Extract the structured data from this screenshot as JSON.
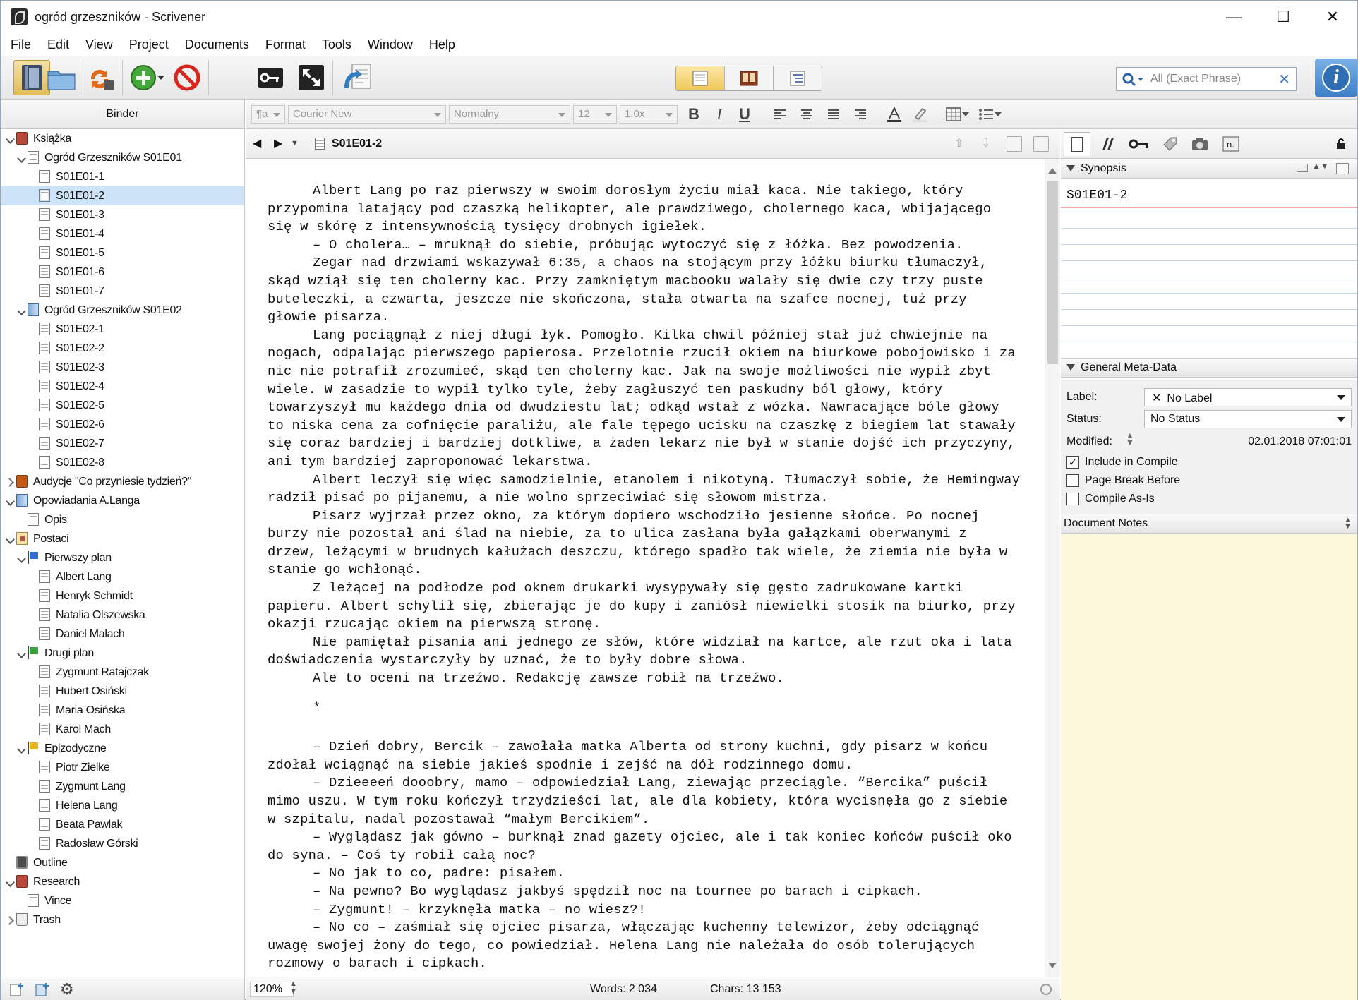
{
  "window": {
    "title": "ogród grzeszników - Scrivener",
    "minimize": "—",
    "maximize": "☐",
    "close": "✕"
  },
  "menu": [
    "File",
    "Edit",
    "View",
    "Project",
    "Documents",
    "Format",
    "Tools",
    "Window",
    "Help"
  ],
  "toolbar": {
    "search_placeholder": "All (Exact Phrase)",
    "search_clear": "✕",
    "info": "i"
  },
  "binder": {
    "header": "Binder",
    "tree": [
      {
        "label": "Książka",
        "icon": "book",
        "depth": 0,
        "tw": "open"
      },
      {
        "label": "Ogród Grzeszników S01E01",
        "icon": "doc",
        "depth": 1,
        "tw": "open"
      },
      {
        "label": "S01E01-1",
        "icon": "doc",
        "depth": 2
      },
      {
        "label": "S01E01-2",
        "icon": "doc",
        "depth": 2,
        "sel": true
      },
      {
        "label": "S01E01-3",
        "icon": "doc",
        "depth": 2
      },
      {
        "label": "S01E01-4",
        "icon": "doc",
        "depth": 2
      },
      {
        "label": "S01E01-5",
        "icon": "doc",
        "depth": 2
      },
      {
        "label": "S01E01-6",
        "icon": "doc",
        "depth": 2
      },
      {
        "label": "S01E01-7",
        "icon": "doc",
        "depth": 2
      },
      {
        "label": "Ogród Grzeszników S01E02",
        "icon": "blue",
        "depth": 1,
        "tw": "open"
      },
      {
        "label": "S01E02-1",
        "icon": "doc",
        "depth": 2
      },
      {
        "label": "S01E02-2",
        "icon": "doc",
        "depth": 2
      },
      {
        "label": "S01E02-3",
        "icon": "doc",
        "depth": 2
      },
      {
        "label": "S01E02-4",
        "icon": "doc",
        "depth": 2
      },
      {
        "label": "S01E02-5",
        "icon": "doc",
        "depth": 2
      },
      {
        "label": "S01E02-6",
        "icon": "doc",
        "depth": 2
      },
      {
        "label": "S01E02-7",
        "icon": "doc",
        "depth": 2
      },
      {
        "label": "S01E02-8",
        "icon": "doc",
        "depth": 2
      },
      {
        "label": "Audycje \"Co przyniesie tydzień?\"",
        "icon": "film",
        "depth": 0,
        "tw": "closed"
      },
      {
        "label": "Opowiadania A.Langa",
        "icon": "blue",
        "depth": 0,
        "tw": "open"
      },
      {
        "label": "Opis",
        "icon": "doc",
        "depth": 1
      },
      {
        "label": "Postaci",
        "icon": "card",
        "depth": 0,
        "tw": "open"
      },
      {
        "label": "Pierwszy plan",
        "icon": "flag",
        "flag": "#2f6fd0",
        "depth": 1,
        "tw": "open"
      },
      {
        "label": "Albert Lang",
        "icon": "doc",
        "depth": 2
      },
      {
        "label": "Henryk Schmidt",
        "icon": "doc",
        "depth": 2
      },
      {
        "label": "Natalia Olszewska",
        "icon": "doc",
        "depth": 2
      },
      {
        "label": "Daniel Małach",
        "icon": "doc",
        "depth": 2
      },
      {
        "label": "Drugi plan",
        "icon": "flag",
        "flag": "#3aa33a",
        "depth": 1,
        "tw": "open"
      },
      {
        "label": "Zygmunt Ratajczak",
        "icon": "doc",
        "depth": 2
      },
      {
        "label": "Hubert Osiński",
        "icon": "doc",
        "depth": 2
      },
      {
        "label": "Maria Osińska",
        "icon": "doc",
        "depth": 2
      },
      {
        "label": "Karol Mach",
        "icon": "doc",
        "depth": 2
      },
      {
        "label": "Epizodyczne",
        "icon": "flag",
        "flag": "#e8b61e",
        "depth": 1,
        "tw": "open"
      },
      {
        "label": "Piotr Zielke",
        "icon": "doc",
        "depth": 2
      },
      {
        "label": "Zygmunt Lang",
        "icon": "doc",
        "depth": 2
      },
      {
        "label": "Helena Lang",
        "icon": "doc",
        "depth": 2
      },
      {
        "label": "Beata Pawlak",
        "icon": "doc",
        "depth": 2
      },
      {
        "label": "Radosław Górski",
        "icon": "doc",
        "depth": 2
      },
      {
        "label": "Outline",
        "icon": "mon",
        "depth": 0
      },
      {
        "label": "Research",
        "icon": "book",
        "depth": 0,
        "tw": "open"
      },
      {
        "label": "Vince",
        "icon": "doc",
        "depth": 1
      },
      {
        "label": "Trash",
        "icon": "trash",
        "depth": 0,
        "tw": "closed"
      }
    ]
  },
  "format": {
    "style": "¶a",
    "font": "Courier New",
    "para": "Normalny",
    "size": "12",
    "spacing": "1.0x",
    "bold": "B",
    "italic": "I",
    "underline": "U"
  },
  "editor": {
    "doc_title": "S01E01-2",
    "paragraphs": [
      "Albert Lang po raz pierwszy w swoim dorosłym życiu miał kaca. Nie takiego, który przypomina latający pod czaszką helikopter, ale prawdziwego, cholernego kaca, wbijającego się w skórę z intensywnością tysięcy drobnych igiełek.",
      "– O cholera… – mruknął do siebie, próbując wytoczyć się z łóżka. Bez powodzenia.",
      "Zegar nad drzwiami wskazywał 6:35, a chaos na stojącym przy łóżku biurku tłumaczył, skąd wziął się ten cholerny kac. Przy zamkniętym macbooku walały się dwie czy trzy puste buteleczki, a czwarta, jeszcze nie skończona, stała otwarta na szafce nocnej, tuż przy głowie pisarza.",
      "Lang pociągnął z niej długi łyk. Pomogło. Kilka chwil później stał już chwiejnie na nogach, odpalając pierwszego papierosa. Przelotnie rzucił okiem na biurkowe pobojowisko i za nic nie potrafił zrozumieć, skąd ten cholerny kac. Jak na swoje możliwości nie wypił zbyt wiele. W zasadzie to wypił tylko tyle, żeby zagłuszyć ten paskudny ból głowy, który towarzyszył mu każdego dnia od dwudziestu lat; odkąd wstał z wózka. Nawracające bóle głowy to niska cena za cofnięcie paraliżu, ale fale tępego ucisku na czaszkę z biegiem lat stawały się coraz bardziej i bardziej dotkliwe, a żaden lekarz nie był w stanie dojść ich przyczyny, ani tym bardziej zaproponować lekarstwa.",
      "Albert leczył się więc samodzielnie, etanolem i nikotyną. Tłumaczył sobie, że Hemingway radził pisać po pijanemu, a nie wolno sprzeciwiać się słowom mistrza.",
      "Pisarz wyjrzał przez okno, za którym dopiero wschodziło jesienne słońce. Po nocnej burzy nie pozostał ani ślad na niebie, za to ulica zasłana była gałązkami oberwanymi z drzew, leżącymi w brudnych kałużach deszczu, którego spadło tak wiele, że ziemia nie była w stanie go wchłonąć.",
      "Z leżącej na podłodze pod oknem drukarki wysypywały się gęsto zadrukowane kartki papieru. Albert schylił się, zbierając je do kupy i zaniósł niewielki stosik na biurko, przy okazji rzucając okiem na pierwszą stronę.",
      "Nie pamiętał pisania ani jednego ze słów, które widział na kartce, ale rzut oka i lata doświadczenia wystarczyły by uznać, że to były dobre słowa.",
      "Ale to oceni na trzeźwo. Redakcję zawsze robił na trzeźwo."
    ],
    "separator": "*",
    "paragraphs2": [
      "– Dzień dobry, Bercik – zawołała matka Alberta od strony kuchni, gdy pisarz w końcu zdołał wciągnąć na siebie jakieś spodnie i zejść na dół rodzinnego domu.",
      "– Dzieeeeń dooobry, mamo – odpowiedział Lang, ziewając przeciągle. “Bercika” puścił mimo uszu. W tym roku kończył trzydzieści lat, ale dla kobiety, która wycisnęła go z siebie w szpitalu, nadal pozostawał “małym Bercikiem”.",
      "– Wyglądasz jak gówno – burknął znad gazety ojciec, ale i tak koniec końców puścił oko do syna. – Coś ty robił całą noc?",
      "– No jak to co, padre: pisałem.",
      "– Na pewno? Bo wyglądasz jakbyś spędził noc na tournee po barach i cipkach.",
      "– Zygmunt! – krzyknęła matka – no wiesz?!",
      "– No co – zaśmiał się ojciec pisarza, włączając kuchenny telewizor, żeby odciągnąć uwagę swojej żony do tego, co powiedział. Helena Lang nie należała do osób tolerujących rozmowy o barach i cipkach."
    ]
  },
  "inspector": {
    "synopsis_header": "Synopsis",
    "synopsis_text": "S01E01-2",
    "meta_header": "General Meta-Data",
    "label_key": "Label:",
    "label_value": "No Label",
    "label_x": "✕",
    "status_key": "Status:",
    "status_value": "No Status",
    "modified_key": "Modified:",
    "modified_value": "02.01.2018 07:01:01",
    "include_compile": "Include in Compile",
    "include_compile_checked": "✓",
    "page_break": "Page Break Before",
    "compile_as_is": "Compile As-Is",
    "notes_header": "Document Notes"
  },
  "footer": {
    "zoom": "120%",
    "words": "Words: 2 034",
    "chars": "Chars: 13 153"
  }
}
